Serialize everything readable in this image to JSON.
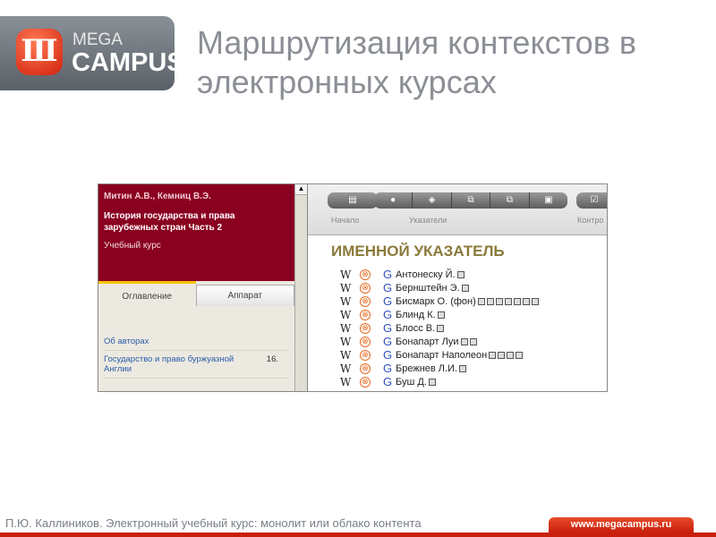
{
  "logo": {
    "mega": "MEGA",
    "campus": "CAMPUS"
  },
  "title": "Маршрутизация контекстов в электронных курсах",
  "course": {
    "authors": "Митин А.В., Кемниц В.Э.",
    "title": "История государства и права зарубежных стран Часть 2",
    "kind": "Учебный курс"
  },
  "tabs": [
    "Оглавление",
    "Аппарат"
  ],
  "toc": [
    {
      "label": "Об авторах",
      "page": ""
    },
    {
      "label": "Государство и право буржуазной Англии",
      "page": "16."
    }
  ],
  "toolbar": {
    "labels": [
      "Начало",
      "Указатели",
      "Контро"
    ]
  },
  "index": {
    "heading": "ИМЕННОЙ УКАЗАТЕЛЬ",
    "entries": [
      {
        "name": "Антонеску Й.",
        "pages": 1
      },
      {
        "name": "Бернштейн Э.",
        "pages": 1
      },
      {
        "name": "Бисмарк О. (фон)",
        "pages": 7
      },
      {
        "name": "Блинд К.",
        "pages": 1
      },
      {
        "name": "Блосс В.",
        "pages": 1
      },
      {
        "name": "Бонапарт Луи",
        "pages": 2
      },
      {
        "name": "Бонапарт Наполеон",
        "pages": 4
      },
      {
        "name": "Брежнев Л.И.",
        "pages": 1
      },
      {
        "name": "Буш Д.",
        "pages": 1
      }
    ]
  },
  "footer": {
    "text": "П.Ю. Каллиников. Электронный учебный курс: монолит или облако контента",
    "url": "www.megacampus.ru"
  }
}
